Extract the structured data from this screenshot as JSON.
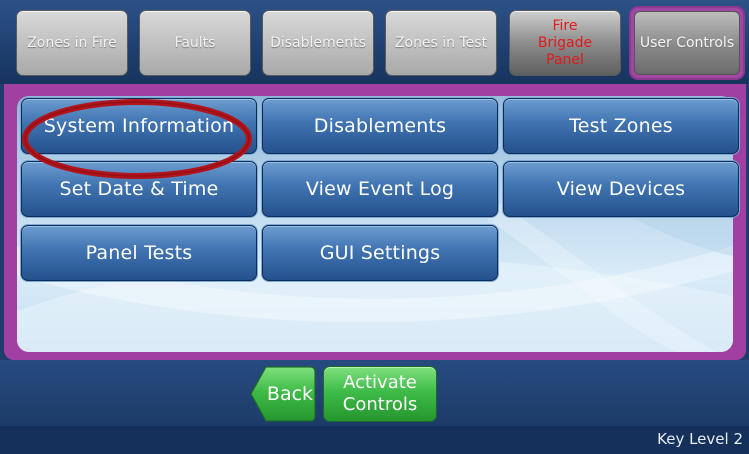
{
  "tabs": [
    {
      "label": "Zones in Fire"
    },
    {
      "label": "Faults"
    },
    {
      "label": "Disablements"
    },
    {
      "label": "Zones in Test"
    },
    {
      "label_lines": [
        "Fire",
        "Brigade",
        "Panel"
      ],
      "color": "#e21a1a"
    },
    {
      "label": "User Controls",
      "active": true
    }
  ],
  "menu": {
    "buttons": [
      {
        "label": "System Information",
        "highlighted": true
      },
      {
        "label": "Disablements"
      },
      {
        "label": "Test Zones"
      },
      {
        "label": "Set Date & Time"
      },
      {
        "label": "View Event Log"
      },
      {
        "label": "View Devices"
      },
      {
        "label": "Panel Tests"
      },
      {
        "label": "GUI Settings"
      }
    ],
    "highlight_color": "#b3141b"
  },
  "footer": {
    "back_label": "Back",
    "activate_label_lines": [
      "Activate",
      "Controls"
    ]
  },
  "status": {
    "key_level": "Key Level 2"
  },
  "colors": {
    "frame": "#a23fa2",
    "button_blue": "#3f73b0",
    "button_green": "#3fbc48"
  }
}
